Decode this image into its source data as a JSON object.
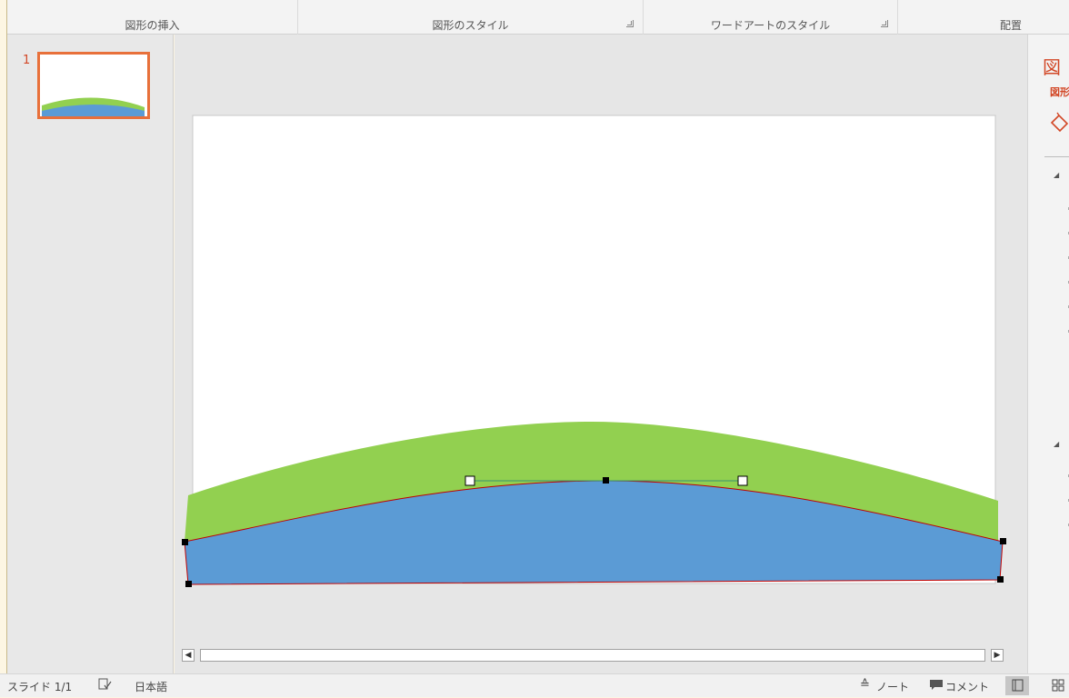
{
  "ribbon": {
    "groups": [
      {
        "label": "図形の挿入"
      },
      {
        "label": "図形のスタイル"
      },
      {
        "label": "ワードアートのスタイル"
      },
      {
        "label": "配置"
      }
    ]
  },
  "thumbnails": [
    {
      "number": "1"
    }
  ],
  "right_pane": {
    "title": "図",
    "subtitle": "図形",
    "fill_icon": "paint-bucket-icon"
  },
  "status_bar": {
    "slide_indicator": "スライド 1/1",
    "proofing_icon": "spellcheck-icon",
    "language": "日本語",
    "notes_label": "ノート",
    "comments_label": "コメント",
    "accent": "#d24726"
  },
  "shapes": {
    "green_color": "#92d050",
    "blue_color": "#5b9bd5",
    "outline_color": "#c00000"
  }
}
